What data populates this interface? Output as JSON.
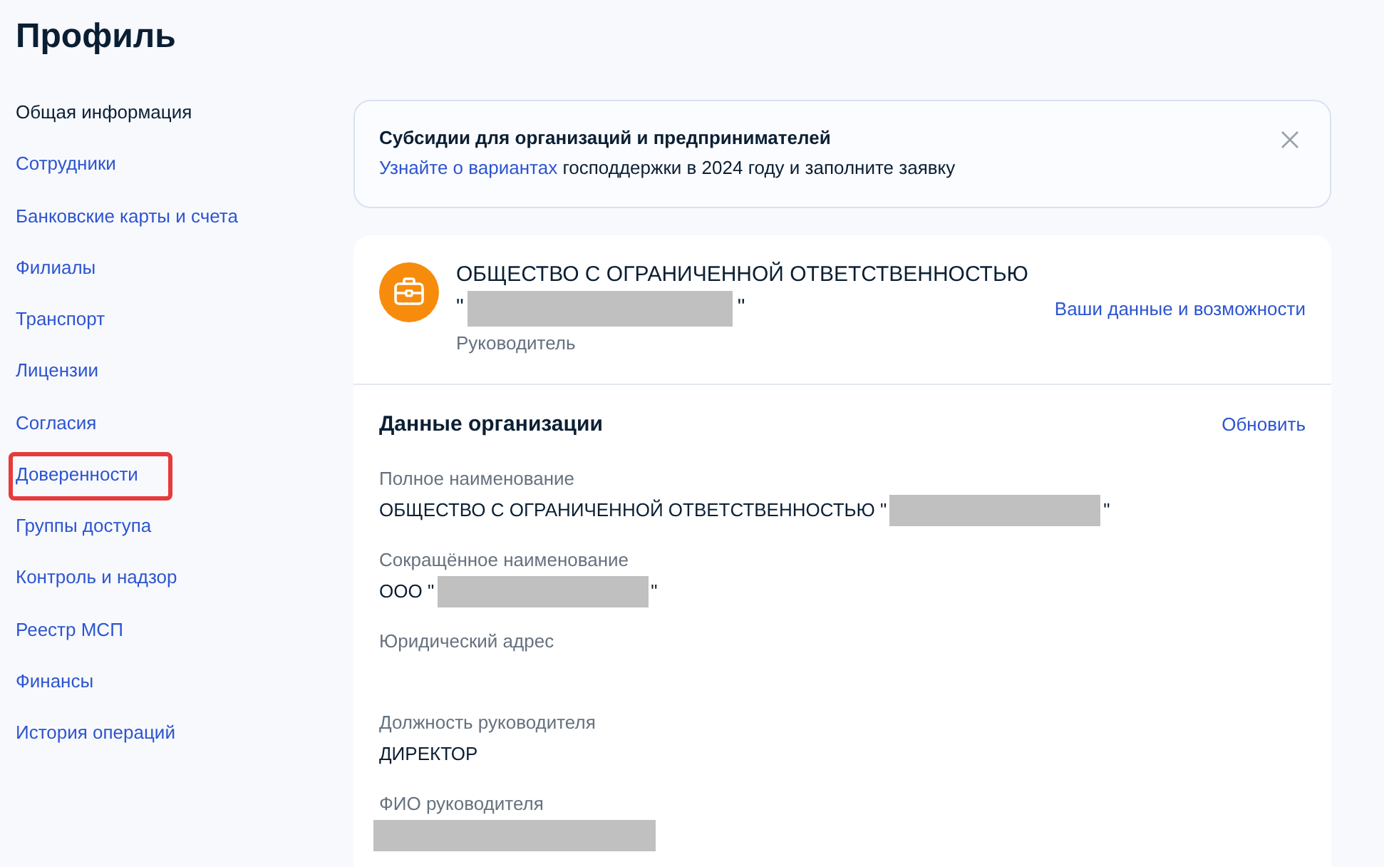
{
  "page_title": "Профиль",
  "sidebar": {
    "items": [
      {
        "label": "Общая информация",
        "selected": true,
        "highlighted": false
      },
      {
        "label": "Сотрудники",
        "selected": false,
        "highlighted": false
      },
      {
        "label": "Банковские карты и счета",
        "selected": false,
        "highlighted": false
      },
      {
        "label": "Филиалы",
        "selected": false,
        "highlighted": false
      },
      {
        "label": "Транспорт",
        "selected": false,
        "highlighted": false
      },
      {
        "label": "Лицензии",
        "selected": false,
        "highlighted": false
      },
      {
        "label": "Согласия",
        "selected": false,
        "highlighted": false
      },
      {
        "label": "Доверенности",
        "selected": false,
        "highlighted": true
      },
      {
        "label": "Группы доступа",
        "selected": false,
        "highlighted": false
      },
      {
        "label": "Контроль и надзор",
        "selected": false,
        "highlighted": false
      },
      {
        "label": "Реестр МСП",
        "selected": false,
        "highlighted": false
      },
      {
        "label": "Финансы",
        "selected": false,
        "highlighted": false
      },
      {
        "label": "История операций",
        "selected": false,
        "highlighted": false
      }
    ]
  },
  "banner": {
    "title": "Субсидии для организаций и предпринимателей",
    "link": "Узнайте о вариантах",
    "text": " господдержки в 2024 году и заполните заявку",
    "dismissible": true
  },
  "organization": {
    "name_lines": [
      [
        {
          "kind": "text",
          "text": "ОБЩЕСТВО С ОГРАНИЧЕННОЙ ОТВЕТСТВЕННОСТЬЮ"
        }
      ],
      [
        {
          "kind": "text",
          "text": "\""
        },
        {
          "kind": "redaction"
        },
        {
          "kind": "text",
          "text": "\""
        }
      ]
    ],
    "role": "Руководитель",
    "link": "Ваши данные и возможности"
  },
  "details": {
    "title": "Данные организации",
    "action": "Обновить",
    "fields": [
      {
        "label": "Полное наименование",
        "value": [
          {
            "kind": "text",
            "text": "ОБЩЕСТВО С ОГРАНИЧЕННОЙ ОТВЕТСТВЕННОСТЬЮ \""
          },
          {
            "kind": "redaction"
          },
          {
            "kind": "text",
            "text": "\""
          }
        ]
      },
      {
        "label": "Сокращённое наименование",
        "value": [
          {
            "kind": "text",
            "text": "ООО \""
          },
          {
            "kind": "redaction"
          },
          {
            "kind": "text",
            "text": "\""
          }
        ]
      },
      {
        "label": "Юридический адрес"
      },
      {
        "label": "Должность руководителя",
        "value": [
          {
            "kind": "text",
            "text": "ДИРЕКТОР"
          }
        ]
      },
      {
        "label": "ФИО руководителя",
        "value": [
          {
            "kind": "redaction"
          }
        ]
      }
    ]
  }
}
